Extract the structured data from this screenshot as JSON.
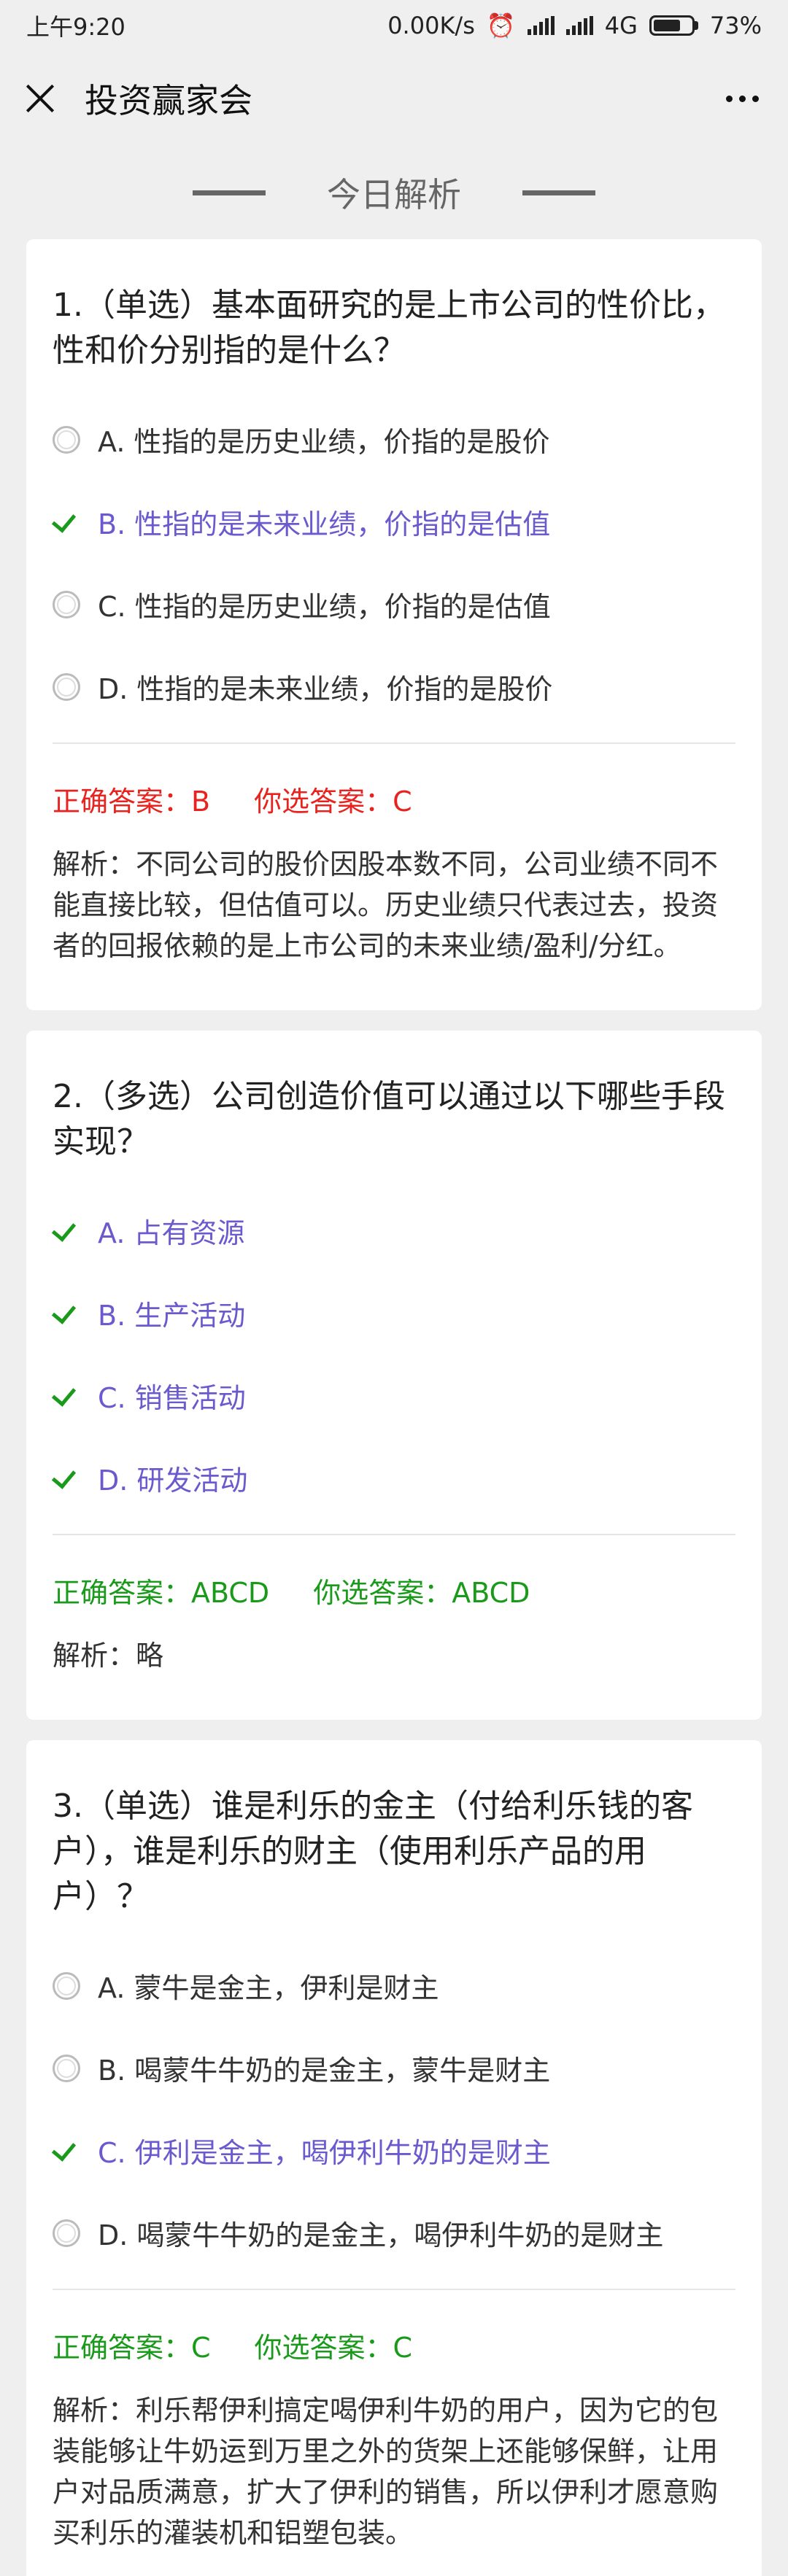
{
  "status": {
    "time": "上午9:20",
    "speed": "0.00K/s",
    "network": "4G",
    "battery": "73%"
  },
  "nav": {
    "title": "投资赢家会"
  },
  "section": {
    "title": "今日解析"
  },
  "colors": {
    "correct_text": "#6a5acd",
    "check_green": "#1a9a1a",
    "wrong_red": "#e8231f"
  },
  "questions": [
    {
      "title": "1.（单选）基本面研究的是上市公司的性价比，性和价分别指的是什么？",
      "options": [
        {
          "label": "A. 性指的是历史业绩，价指的是股价",
          "correct": false
        },
        {
          "label": "B. 性指的是未来业绩，价指的是估值",
          "correct": true
        },
        {
          "label": "C. 性指的是历史业绩，价指的是估值",
          "correct": false
        },
        {
          "label": "D. 性指的是未来业绩，价指的是股价",
          "correct": false
        }
      ],
      "correct_answer": "正确答案：B",
      "your_answer": "你选答案：C",
      "is_right": false,
      "analysis": "解析：不同公司的股价因股本数不同，公司业绩不同不能直接比较，但估值可以。历史业绩只代表过去，投资者的回报依赖的是上市公司的未来业绩/盈利/分红。"
    },
    {
      "title": "2.（多选）公司创造价值可以通过以下哪些手段实现？",
      "options": [
        {
          "label": "A. 占有资源",
          "correct": true
        },
        {
          "label": "B. 生产活动",
          "correct": true
        },
        {
          "label": "C. 销售活动",
          "correct": true
        },
        {
          "label": "D. 研发活动",
          "correct": true
        }
      ],
      "correct_answer": "正确答案：ABCD",
      "your_answer": "你选答案：ABCD",
      "is_right": true,
      "analysis": "解析：略"
    },
    {
      "title": "3.（单选）谁是利乐的金主（付给利乐钱的客户），谁是利乐的财主（使用利乐产品的用户）？",
      "options": [
        {
          "label": "A. 蒙牛是金主，伊利是财主",
          "correct": false
        },
        {
          "label": "B. 喝蒙牛牛奶的是金主，蒙牛是财主",
          "correct": false
        },
        {
          "label": "C. 伊利是金主，喝伊利牛奶的是财主",
          "correct": true
        },
        {
          "label": "D. 喝蒙牛牛奶的是金主，喝伊利牛奶的是财主",
          "correct": false
        }
      ],
      "correct_answer": "正确答案：C",
      "your_answer": "你选答案：C",
      "is_right": true,
      "analysis": "解析：利乐帮伊利搞定喝伊利牛奶的用户，因为它的包装能够让牛奶运到万里之外的货架上还能够保鲜，让用户对品质满意，扩大了伊利的销售，所以伊利才愿意购买利乐的灌装机和铝塑包装。"
    }
  ]
}
